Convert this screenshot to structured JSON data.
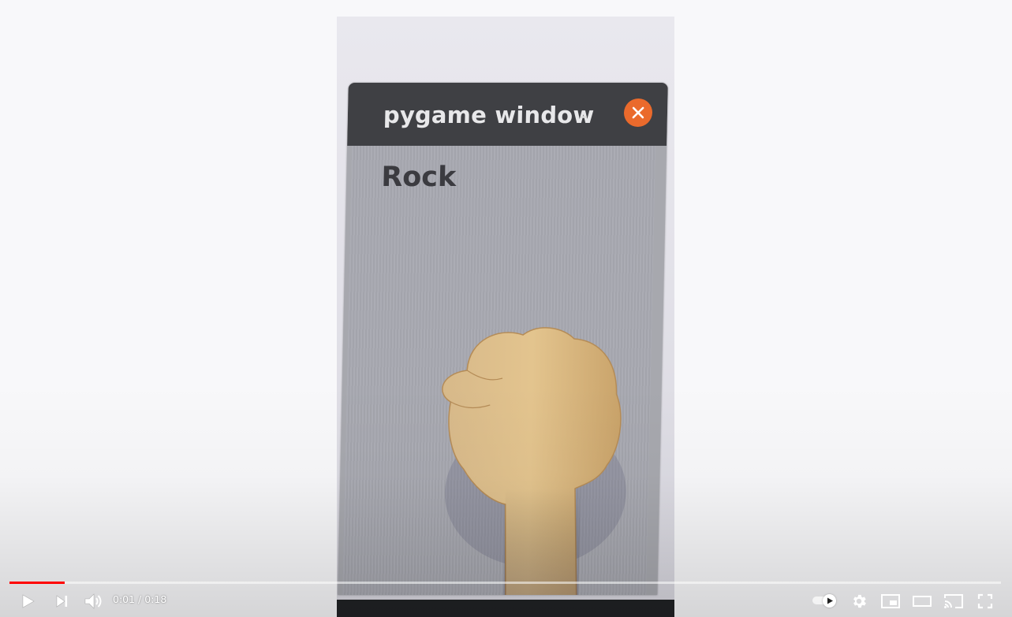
{
  "video": {
    "window_title": "pygame window",
    "minimize_glyph": "–",
    "prediction_label": "Rock",
    "close_icon": "close-icon",
    "hand_icon": "fist-hand"
  },
  "player": {
    "progress_fraction": 0.056,
    "progress_color": "#ff0000",
    "current_time": "0:01",
    "separator": " / ",
    "duration": "0:18",
    "controls": {
      "play": "play-icon",
      "next": "next-icon",
      "volume": "volume-icon",
      "autoplay": "autoplay-toggle",
      "settings": "gear-icon",
      "miniplayer": "miniplayer-icon",
      "theater": "theater-mode-icon",
      "cast": "cast-icon",
      "fullscreen": "fullscreen-icon"
    }
  }
}
